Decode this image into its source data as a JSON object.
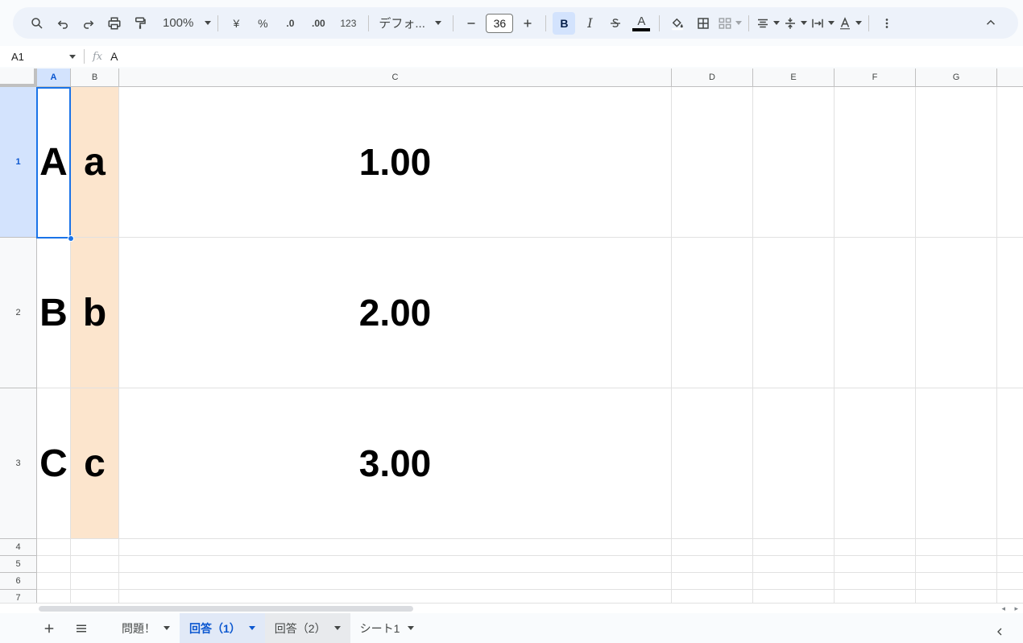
{
  "toolbar": {
    "zoom": "100%",
    "currency": "¥",
    "percent": "%",
    "decrease_decimal": ".0",
    "increase_decimal": ".00",
    "number_format": "123",
    "font": "デフォ...",
    "font_size": "36",
    "bold": "B",
    "italic": "I",
    "text_color_letter": "A",
    "text_color": "#000000"
  },
  "formula_bar": {
    "cell_ref": "A1",
    "value": "A"
  },
  "columns": [
    "A",
    "B",
    "C",
    "D",
    "E",
    "F",
    "G"
  ],
  "rows": [
    "1",
    "2",
    "3",
    "4",
    "5",
    "6",
    "7"
  ],
  "cells": {
    "A1": "A",
    "B1": "a",
    "C1": "1.00",
    "A2": "B",
    "B2": "b",
    "C2": "2.00",
    "A3": "C",
    "B3": "c",
    "C3": "3.00"
  },
  "colors": {
    "column_b_fill": "#fce5cd",
    "selection": "#1a73e8"
  },
  "sheets": [
    {
      "label": "問題！"
    },
    {
      "label": "回答（1）",
      "active": true
    },
    {
      "label": "回答（2）"
    },
    {
      "label": "シート1"
    }
  ]
}
